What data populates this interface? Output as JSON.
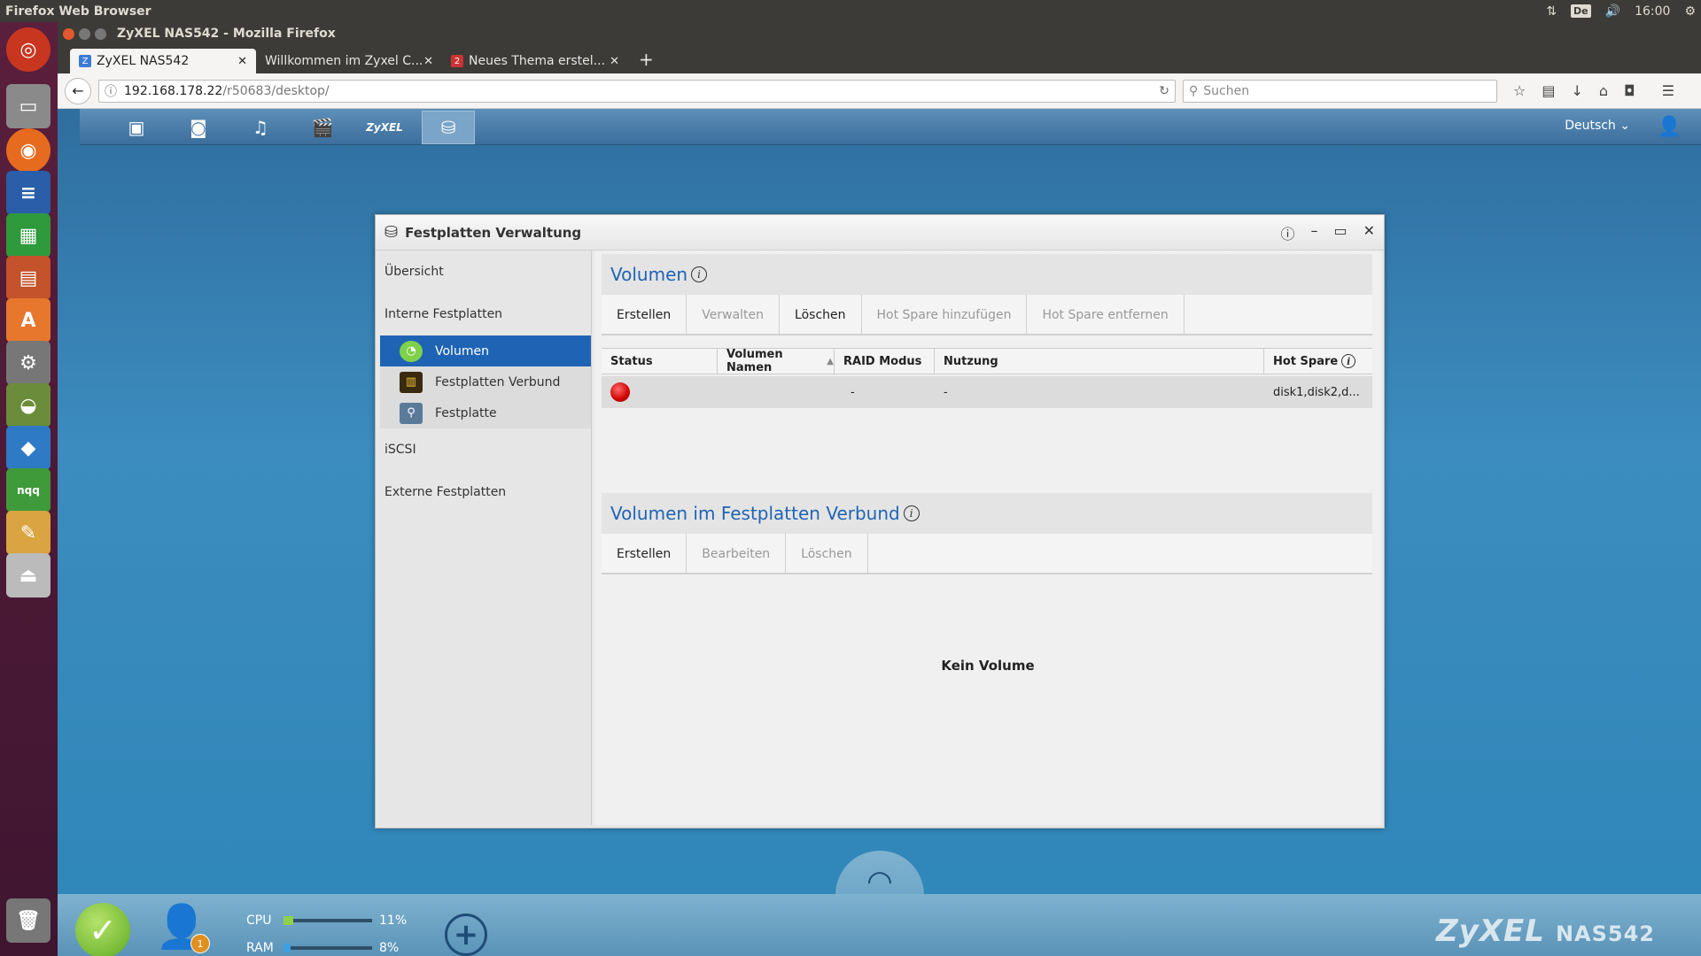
{
  "system": {
    "title": "Firefox Web Browser",
    "kbd": "De",
    "time": "16:00"
  },
  "browser": {
    "window_title": "ZyXEL NAS542 - Mozilla Firefox",
    "tabs": [
      {
        "label": "ZyXEL NAS542",
        "fav": "Z"
      },
      {
        "label": "Willkommen im Zyxel C...",
        "fav": ""
      },
      {
        "label": "Neues Thema erstel...",
        "fav": "2"
      }
    ],
    "url_host": "192.168.178.22",
    "url_path": "/r50683/desktop/",
    "search_placeholder": "Suchen"
  },
  "app": {
    "language": "Deutsch",
    "dialog_title": "Festplatten Verwaltung",
    "nav": {
      "overview": "Übersicht",
      "internal": "Interne Festplatten",
      "sub": [
        "Volumen",
        "Festplatten Verbund",
        "Festplatte"
      ],
      "iscsi": "iSCSI",
      "external": "Externe Festplatten"
    },
    "volumes": {
      "title": "Volumen",
      "buttons": [
        "Erstellen",
        "Verwalten",
        "Löschen",
        "Hot Spare hinzufügen",
        "Hot Spare entfernen"
      ],
      "columns": [
        "Status",
        "Volumen Namen",
        "RAID Modus",
        "Nutzung",
        "Hot Spare"
      ],
      "row": {
        "name": "",
        "raid": "-",
        "usage": "-",
        "hotspare": "disk1,disk2,d..."
      }
    },
    "pool": {
      "title": "Volumen im Festplatten Verbund",
      "buttons": [
        "Erstellen",
        "Bearbeiten",
        "Löschen"
      ],
      "empty": "Kein Volume"
    },
    "status": {
      "cpu_label": "CPU",
      "cpu_value": "11%",
      "cpu_level": 0.11,
      "ram_label": "RAM",
      "ram_value": "8%",
      "ram_level": 0.08,
      "user_badge": "1"
    },
    "brand": "ZyXEL",
    "model": "NAS542"
  },
  "colors": {
    "accent": "#1f64b4",
    "cpu": "#8ed14a",
    "ram": "#3ea0e0"
  }
}
